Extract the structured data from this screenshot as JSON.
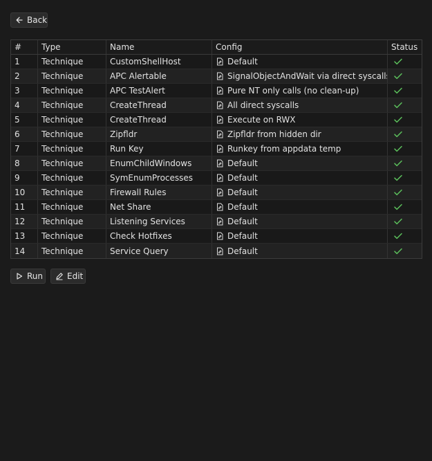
{
  "back_button": {
    "label": "Back"
  },
  "table": {
    "headers": {
      "num": "#",
      "type": "Type",
      "name": "Name",
      "config": "Config",
      "status": "Status"
    },
    "rows": [
      {
        "num": "1",
        "type": "Technique",
        "name": "CustomShellHost",
        "config": "Default",
        "status": "success"
      },
      {
        "num": "2",
        "type": "Technique",
        "name": "APC Alertable",
        "config": "SignalObjectAndWait via direct syscalls",
        "status": "success"
      },
      {
        "num": "3",
        "type": "Technique",
        "name": "APC TestAlert",
        "config": "Pure NT only calls (no clean-up)",
        "status": "success"
      },
      {
        "num": "4",
        "type": "Technique",
        "name": "CreateThread",
        "config": "All direct syscalls",
        "status": "success"
      },
      {
        "num": "5",
        "type": "Technique",
        "name": "CreateThread",
        "config": "Execute on RWX",
        "status": "success"
      },
      {
        "num": "6",
        "type": "Technique",
        "name": "Zipfldr",
        "config": "Zipfldr from hidden dir",
        "status": "success"
      },
      {
        "num": "7",
        "type": "Technique",
        "name": "Run Key",
        "config": "Runkey from appdata temp",
        "status": "success"
      },
      {
        "num": "8",
        "type": "Technique",
        "name": "EnumChildWindows",
        "config": "Default",
        "status": "success"
      },
      {
        "num": "9",
        "type": "Technique",
        "name": "SymEnumProcesses",
        "config": "Default",
        "status": "success"
      },
      {
        "num": "10",
        "type": "Technique",
        "name": "Firewall Rules",
        "config": "Default",
        "status": "success"
      },
      {
        "num": "11",
        "type": "Technique",
        "name": "Net Share",
        "config": "Default",
        "status": "success"
      },
      {
        "num": "12",
        "type": "Technique",
        "name": "Listening Services",
        "config": "Default",
        "status": "success"
      },
      {
        "num": "13",
        "type": "Technique",
        "name": "Check Hotfixes",
        "config": "Default",
        "status": "success"
      },
      {
        "num": "14",
        "type": "Technique",
        "name": "Service Query",
        "config": "Default",
        "status": "success"
      }
    ]
  },
  "actions": {
    "run_label": "Run",
    "edit_label": "Edit"
  },
  "colors": {
    "success": "#5cc15c",
    "background": "#1b1b1b"
  },
  "icons": {
    "back": "arrow-left-icon",
    "config": "document-edit-icon",
    "status": "check-icon",
    "run": "play-icon",
    "edit": "pencil-icon"
  }
}
